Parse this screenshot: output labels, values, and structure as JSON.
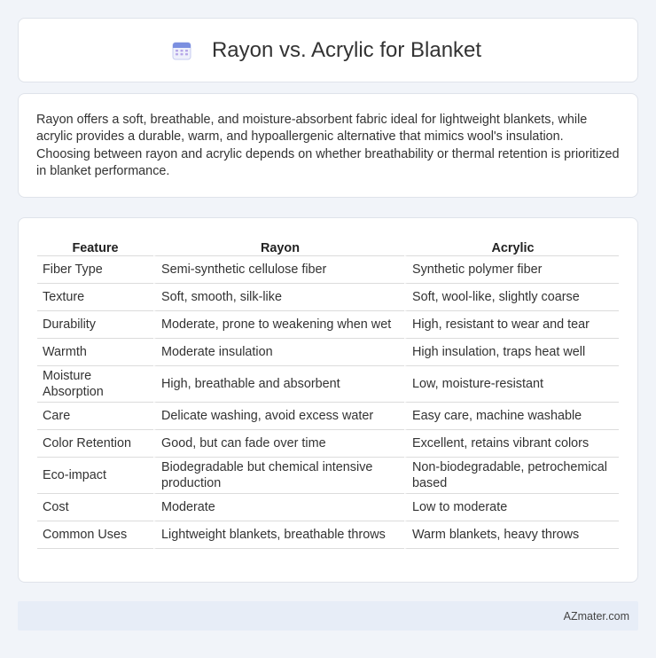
{
  "header": {
    "title": "Rayon vs. Acrylic for Blanket",
    "icon": "calendar-icon"
  },
  "description": "Rayon offers a soft, breathable, and moisture-absorbent fabric ideal for lightweight blankets, while acrylic provides a durable, warm, and hypoallergenic alternative that mimics wool's insulation. Choosing between rayon and acrylic depends on whether breathability or thermal retention is prioritized in blanket performance.",
  "table": {
    "headers": [
      "Feature",
      "Rayon",
      "Acrylic"
    ],
    "rows": [
      [
        "Fiber Type",
        "Semi-synthetic cellulose fiber",
        "Synthetic polymer fiber"
      ],
      [
        "Texture",
        "Soft, smooth, silk-like",
        "Soft, wool-like, slightly coarse"
      ],
      [
        "Durability",
        "Moderate, prone to weakening when wet",
        "High, resistant to wear and tear"
      ],
      [
        "Warmth",
        "Moderate insulation",
        "High insulation, traps heat well"
      ],
      [
        "Moisture Absorption",
        "High, breathable and absorbent",
        "Low, moisture-resistant"
      ],
      [
        "Care",
        "Delicate washing, avoid excess water",
        "Easy care, machine washable"
      ],
      [
        "Color Retention",
        "Good, but can fade over time",
        "Excellent, retains vibrant colors"
      ],
      [
        "Eco-impact",
        "Biodegradable but chemical intensive production",
        "Non-biodegradable, petrochemical based"
      ],
      [
        "Cost",
        "Moderate",
        "Low to moderate"
      ],
      [
        "Common Uses",
        "Lightweight blankets, breathable throws",
        "Warm blankets, heavy throws"
      ]
    ]
  },
  "footer": {
    "brand": "AZmater.com"
  },
  "colors": {
    "page_bg": "#f1f4f9",
    "card_bg": "#ffffff",
    "footer_bg": "#e7edf7",
    "icon_accent": "#7b8fe0"
  }
}
